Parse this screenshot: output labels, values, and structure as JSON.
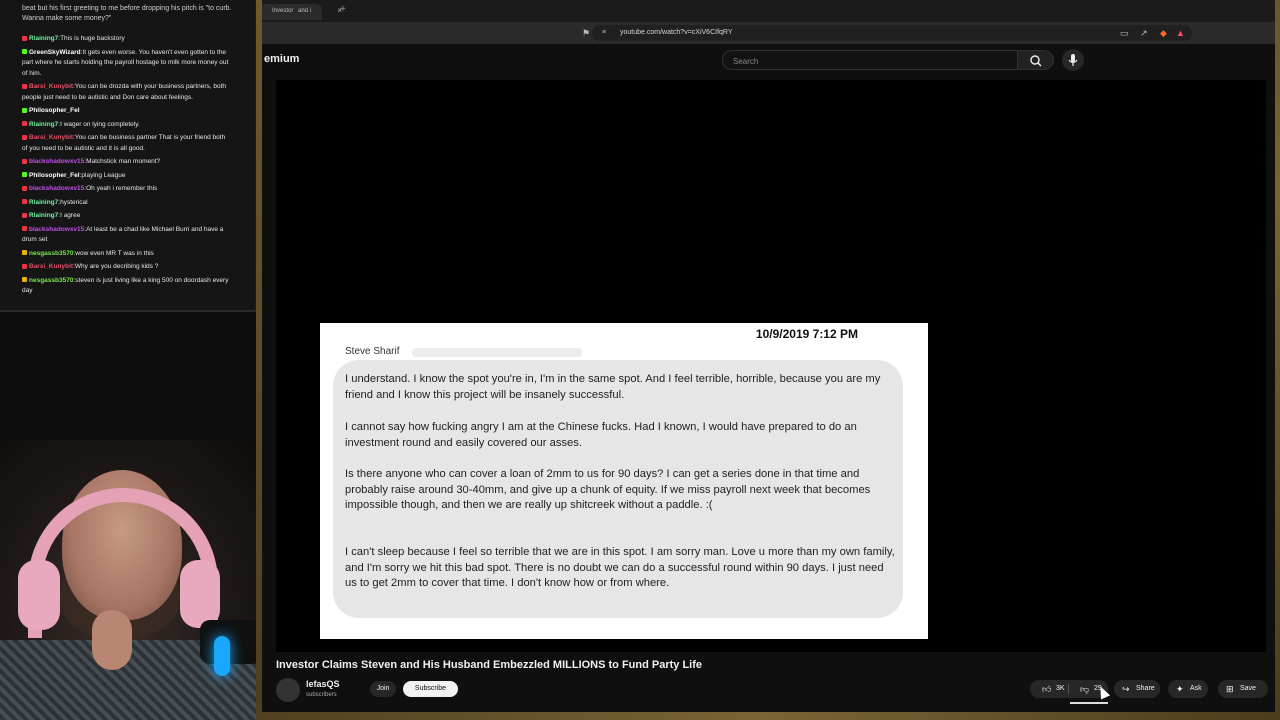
{
  "chat": {
    "top_text": "beat but his first greeting to me before dropping his pitch is \"to curb. Wanna make some money?\"",
    "messages": [
      {
        "user": "Rlaining7",
        "color": "#6ff0a0",
        "badge": "#e34",
        "text": "This is huge backstory"
      },
      {
        "user": "GreenSkyWizard",
        "color": "#ffffff",
        "badge": "#53fc18",
        "text": "It gets even worse. You haven't even gotten to the part where he starts holding the payroll hostage to milk more money out of him."
      },
      {
        "user": "Barsi_Kunybit",
        "color": "#e0506a",
        "badge": "#e34",
        "text": "You can be drozda with your business partners, both people just need to be autistic and Don care about feelings."
      },
      {
        "user": "Philosopher_Fel",
        "color": "#ffffff",
        "badge": "#53fc18",
        "text": ""
      },
      {
        "user": "Rlaining7",
        "color": "#6ff0a0",
        "badge": "#e34",
        "text": "I wager on lying completely."
      },
      {
        "user": "Barsi_Kunybit",
        "color": "#e0506a",
        "badge": "#e34",
        "text": "You can be business partner That is your friend both of you need to be autistic and it is all good."
      },
      {
        "user": "blackshadowxv15",
        "color": "#c050e8",
        "badge": "#e34",
        "text": "Matchstick man moment?"
      },
      {
        "user": "Philosopher_Fel",
        "color": "#ffffff",
        "badge": "#53fc18",
        "text": "playing League"
      },
      {
        "user": "blackshadowxv15",
        "color": "#c050e8",
        "badge": "#e34",
        "text": "Oh yeah i remember this"
      },
      {
        "user": "Rlaining7",
        "color": "#6ff0a0",
        "badge": "#e34",
        "text": "hysterical"
      },
      {
        "user": "Rlaining7",
        "color": "#6ff0a0",
        "badge": "#e34",
        "text": "I agree"
      },
      {
        "user": "blackshadowxv15",
        "color": "#c050e8",
        "badge": "#e34",
        "text": "At least be a chad like Michael Burri and have a drum set"
      },
      {
        "user": "nesgassb3570",
        "color": "#7be84a",
        "badge": "#e6b400",
        "text": "wow even MR T was in this"
      },
      {
        "user": "Barsi_Kunybit",
        "color": "#e0506a",
        "badge": "#e34",
        "text": "Why are you decribing kids ?"
      },
      {
        "user": "nesgassb3570",
        "color": "#7be84a",
        "badge": "#e6b400",
        "text": "steven is just living like a king 500 on doordash every day"
      }
    ]
  },
  "browser": {
    "tab_active": "Investor",
    "tab_second": "and i",
    "url": "youtube.com/watch?v=cXiV6CIfqRY"
  },
  "youtube": {
    "logo_text": "emium",
    "search_placeholder": "Search",
    "doc": {
      "date": "10/9/2019 7:12 PM",
      "sender": "Steve Sharif",
      "paragraphs": [
        "I understand. I know the spot you're in, I'm in the same spot. And I feel terrible, horrible, because you are my friend and I know this project will be insanely successful.",
        "I cannot say how fucking angry I am at the Chinese fucks. Had I known, I would have prepared to do an investment round and easily covered our asses.",
        "Is there anyone who can cover a loan of 2mm to us for 90 days? I can get a series done in that time and probably raise around 30-40mm, and give up a chunk of equity. If we miss payroll next week that becomes impossible though, and then we are really up shitcreek without a paddle. :(",
        "I can't sleep because I feel so terrible that we are in this spot. I am sorry man. Love u more than my own family, and I'm sorry we hit this bad spot. There is no doubt we can do a successful round within 90 days. I just need us to get 2mm to cover that time. I don't know how or from where."
      ]
    },
    "video_title": "Investor Claims Steven and His Husband Embezzled MILLIONS to Fund Party Life",
    "channel_name": "lefasQS",
    "channel_subs": "subscribers",
    "join_label": "Join",
    "subscribe_label": "Subscribe",
    "likes": "3K",
    "dislikes": "29",
    "share_label": "Share",
    "ask_label": "Ask",
    "save_label": "Save"
  }
}
